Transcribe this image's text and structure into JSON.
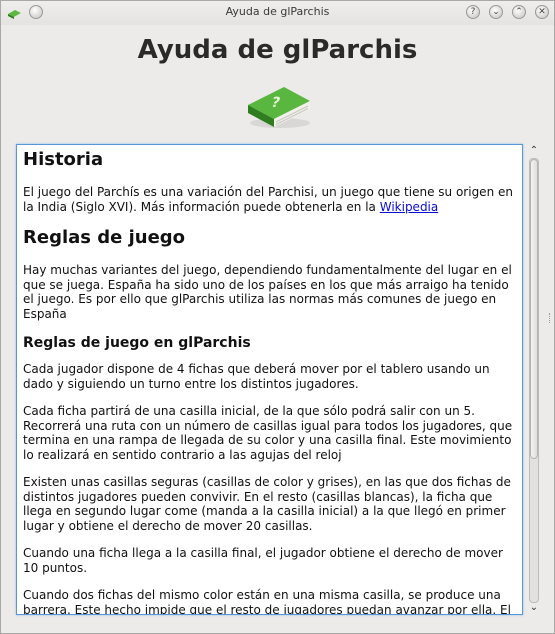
{
  "window": {
    "title": "Ayuda de glParchis",
    "buttons": {
      "help": "?",
      "minimize": "⌄",
      "maximize": "⌃",
      "close": "✕"
    }
  },
  "header": {
    "title": "Ayuda de glParchis",
    "icon": "green-book-question-icon"
  },
  "content": {
    "historia": {
      "heading": "Historia",
      "text_before_link": "El juego del Parchís es una variación del Parchisi, un juego que tiene su origen en la India (Siglo XVI). Más información puede obtenerla en la ",
      "link": "Wikipedia"
    },
    "reglas": {
      "heading": "Reglas de juego",
      "text": "Hay muchas variantes del juego, dependiendo fundamentalmente del lugar en el que se juega. España ha sido uno de los países en los que más arraigo ha tenido el juego. Es por ello que glParchis utiliza las normas más comunes de juego en España"
    },
    "reglas_glparchis": {
      "heading": "Reglas de juego en glParchis",
      "paragraphs": [
        "Cada jugador dispone de 4 fichas que deberá mover por el tablero usando un dado y siguiendo un turno entre los distintos jugadores.",
        "Cada ficha partirá de una casilla inicial, de la que sólo podrá salir con un 5. Recorrerá una ruta con un número de casillas igual para todos los jugadores, que termina en una rampa de llegada de su color y una casilla final. Este movimiento lo realizará en sentido contrario a las agujas del reloj",
        "Existen unas casillas seguras (casillas de color y grises), en las que dos fichas de distintos jugadores pueden convivir. En el resto (casillas blancas), la ficha que llega en segundo lugar come (manda a la casilla inicial) a la que llegó en primer lugar y obtiene el derecho de mover 20 casillas.",
        "Cuando una ficha llega a la casilla final, el jugador obtiene el derecho de mover 10 puntos.",
        "Cuando dos fichas del mismo color están en una misma casilla, se produce una barrera. Este hecho impide que el resto de jugadores puedan avanzar por ella. El jugador está obligado a abrir la barrera cuando obtiene un 6 con el dado."
      ]
    }
  },
  "colors": {
    "link": "#0b0bd8",
    "focus_border": "#5a96d6",
    "book_green": "#3f9a2e"
  }
}
